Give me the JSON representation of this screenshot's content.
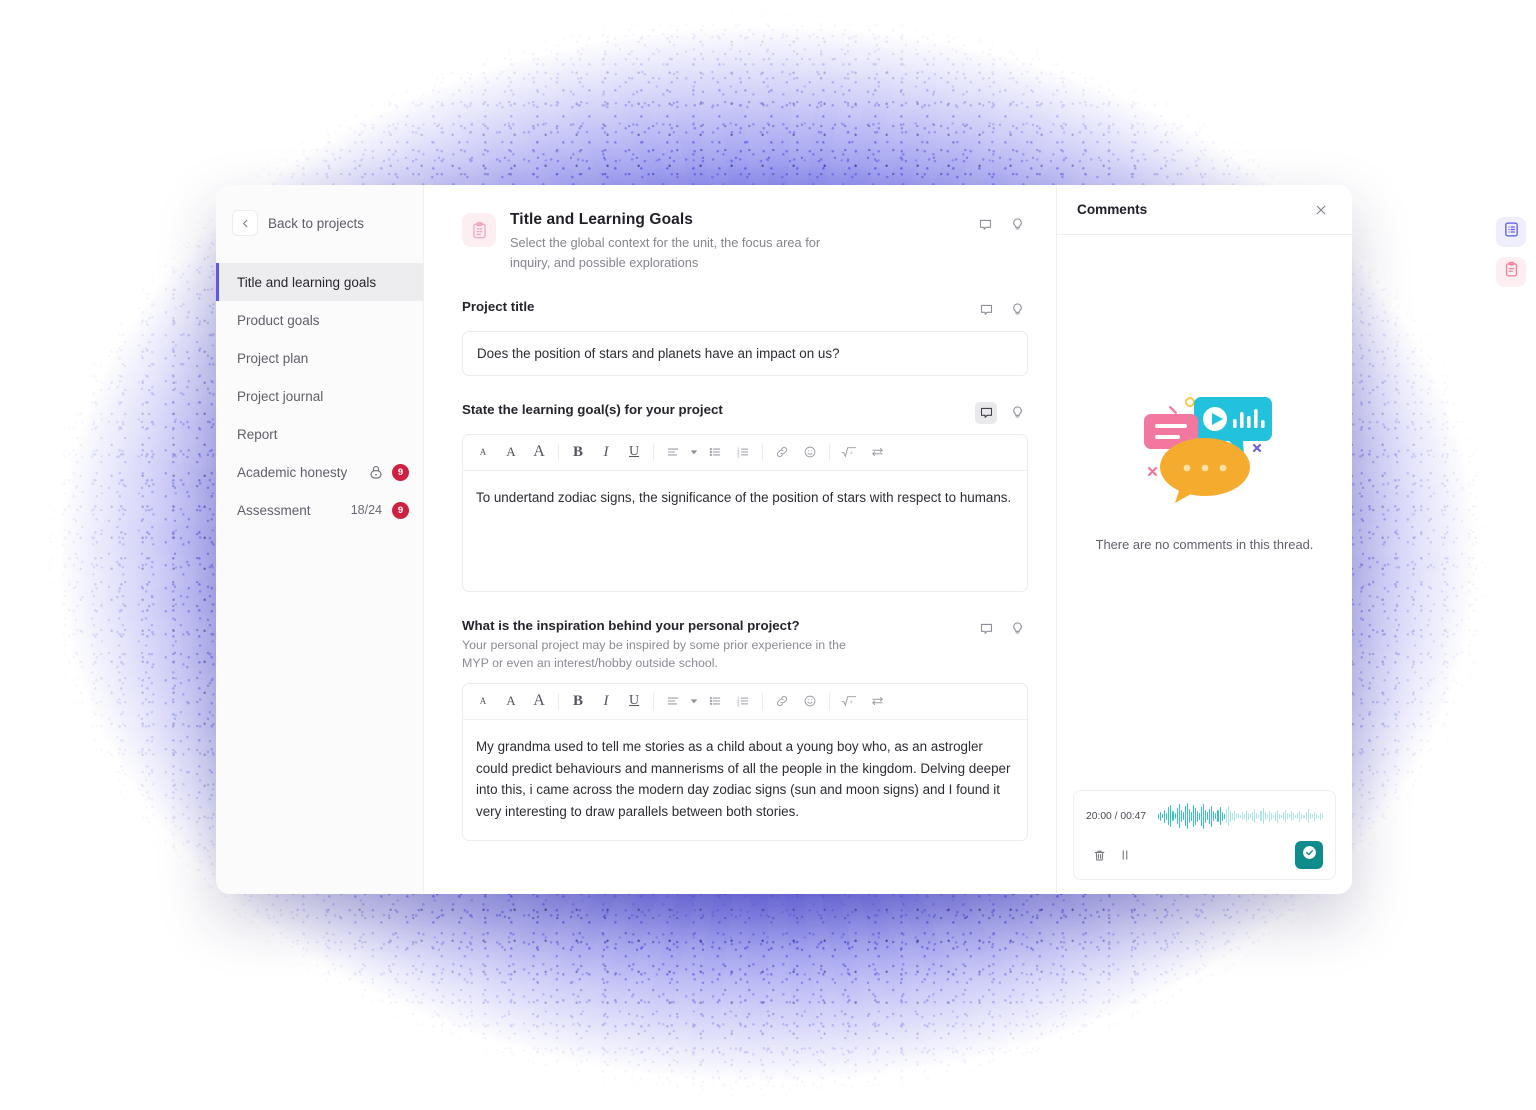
{
  "theme": {
    "accent": "#5b59e6",
    "badge": "#cf2042",
    "teal": "#0e8c8c",
    "pink": "#ef8199"
  },
  "sidebar": {
    "back_label": "Back to projects",
    "back_icon": "chevron-left-icon",
    "items": [
      {
        "label": "Title and learning goals",
        "active": true
      },
      {
        "label": "Product goals",
        "active": false
      },
      {
        "label": "Project plan",
        "active": false
      },
      {
        "label": "Project journal",
        "active": false
      },
      {
        "label": "Report",
        "active": false
      },
      {
        "label": "Academic honesty",
        "active": false,
        "lock": true,
        "badge": "9"
      },
      {
        "label": "Assessment",
        "active": false,
        "fraction": "18/24",
        "badge": "9"
      }
    ]
  },
  "main": {
    "section": {
      "icon": "clipboard-icon",
      "title": "Title and Learning Goals",
      "subtitle": "Select the global context for the unit, the focus area for inquiry, and possible explorations",
      "comment_icon": "comment-icon",
      "hint_icon": "lightbulb-icon"
    },
    "toolbar": {
      "items": [
        {
          "name": "font-size-small-icon",
          "glyph": "A"
        },
        {
          "name": "font-size-medium-icon",
          "glyph": "A"
        },
        {
          "name": "font-size-large-icon",
          "glyph": "A"
        },
        {
          "name": "bold-icon",
          "glyph": "B"
        },
        {
          "name": "italic-icon",
          "glyph": "I"
        },
        {
          "name": "underline-icon",
          "glyph": "U"
        },
        {
          "name": "align-left-icon",
          "glyph": "≡"
        },
        {
          "name": "align-dropdown-caret-icon",
          "glyph": "▾"
        },
        {
          "name": "bullet-list-icon",
          "glyph": "☰"
        },
        {
          "name": "numbered-list-icon",
          "glyph": "☰"
        },
        {
          "name": "link-icon",
          "glyph": "⚭"
        },
        {
          "name": "emoji-icon",
          "glyph": "☺"
        },
        {
          "name": "math-formula-icon",
          "glyph": "√x"
        },
        {
          "name": "swap-icon",
          "glyph": "⇌"
        }
      ]
    },
    "fields": [
      {
        "label": "Project title",
        "help": "",
        "value": "Does the position of stars and planets have an impact on us?",
        "type": "input",
        "comment_active": false
      },
      {
        "label": "State the learning goal(s) for your project",
        "help": "",
        "value": "To undertand zodiac signs, the significance of the position of stars with respect to humans.",
        "type": "editor",
        "comment_active": true
      },
      {
        "label": "What is the inspiration behind your personal project?",
        "help": "Your personal project may be inspired by some prior experience in the MYP or even an interest/hobby outside school.",
        "value": "My grandma used to tell me stories as a child about a young boy who, as an astrogler could predict behaviours and mannerisms of all the people in the kingdom. Delving deeper into this, i came across the modern day zodiac signs (sun and moon signs) and I found it very interesting to draw parallels between both stories.",
        "type": "editor",
        "comment_active": false
      }
    ]
  },
  "comments": {
    "title": "Comments",
    "close_icon": "close-icon",
    "empty_text": "There are no comments in this thread.",
    "empty_illustration": "chat-bubbles-illustration",
    "player": {
      "time": "20:00 / 00:47",
      "delete_icon": "trash-icon",
      "pause_icon": "pause-icon",
      "send_icon": "check-circle-icon"
    }
  },
  "rail": {
    "buttons": [
      {
        "name": "document-list-icon",
        "active": true
      },
      {
        "name": "clipboard-tab-icon",
        "active": false
      }
    ]
  }
}
